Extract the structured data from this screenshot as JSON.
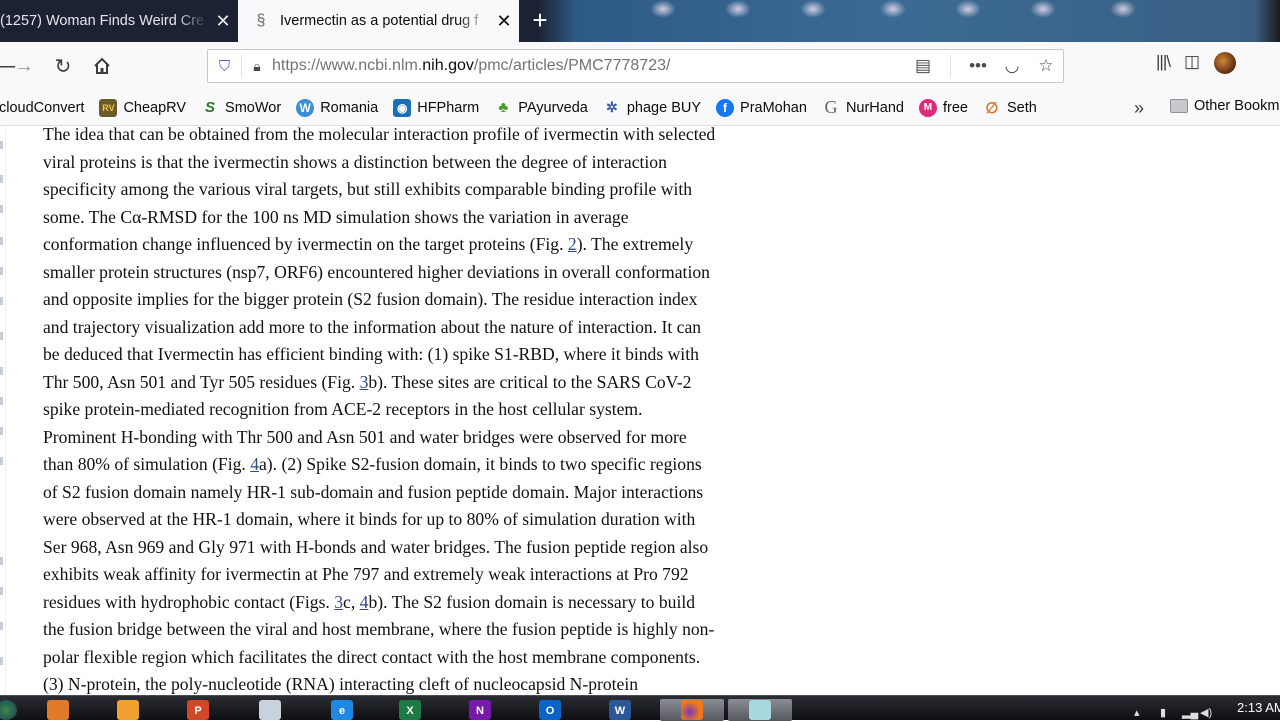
{
  "browser": {
    "tabs": [
      {
        "title": "(1257) Woman Finds Weird Cre",
        "active": false,
        "favicon": "youtube-icon"
      },
      {
        "title": "Ivermectin as a potential drug f",
        "active": true,
        "favicon": "ncbi-helix-icon"
      }
    ],
    "new_tab_label": "+",
    "url_prefix": "https://www.ncbi.nlm.",
    "url_domain": "nih.gov",
    "url_suffix": "/pmc/articles/PMC7778723/",
    "bookmarks": [
      {
        "label": "cloudConvert",
        "icon": "cloudconvert-icon"
      },
      {
        "label": "CheapRV",
        "icon": "rv-icon"
      },
      {
        "label": "SmoWor",
        "icon": "smowor-icon"
      },
      {
        "label": "Romania",
        "icon": "wordpress-icon"
      },
      {
        "label": "HFPharm",
        "icon": "hfpharm-icon"
      },
      {
        "label": "PAyurveda",
        "icon": "palm-icon"
      },
      {
        "label": "phage BUY",
        "icon": "phage-icon"
      },
      {
        "label": "PraMohan",
        "icon": "facebook-icon"
      },
      {
        "label": "NurHand",
        "icon": "google-icon"
      },
      {
        "label": "free",
        "icon": "m-icon"
      },
      {
        "label": "Seth",
        "icon": "seth-icon"
      }
    ],
    "other_bookmarks_label": "Other Bookmarks"
  },
  "article": {
    "lines": [
      [
        {
          "t": "The idea that can be obtained from the molecular interaction profile of ivermectin with selected"
        }
      ],
      [
        {
          "t": "viral proteins is that the ivermectin shows a distinction between the degree of interaction"
        }
      ],
      [
        {
          "t": "specificity among the various viral targets, but still exhibits comparable binding profile with"
        }
      ],
      [
        {
          "t": "some. The Cα-RMSD for the 100 ns MD simulation shows the variation in average"
        }
      ],
      [
        {
          "t": "conformation change influenced by ivermectin on the target proteins (Fig. "
        },
        {
          "t": "2",
          "link": true
        },
        {
          "t": "). The extremely"
        }
      ],
      [
        {
          "t": "smaller protein structures (nsp7, ORF6) encountered higher deviations in overall conformation"
        }
      ],
      [
        {
          "t": "and opposite implies for the bigger protein (S2 fusion domain). The residue interaction index"
        }
      ],
      [
        {
          "t": "and trajectory visualization add more to the information about the nature of interaction. It can"
        }
      ],
      [
        {
          "t": "be deduced that Ivermectin has efficient binding with: (1) spike S1-RBD, where it binds with"
        }
      ],
      [
        {
          "t": "Thr 500, Asn 501 and Tyr 505 residues (Fig. "
        },
        {
          "t": "3",
          "link": true
        },
        {
          "t": "b). These sites are critical to the SARS CoV-2"
        }
      ],
      [
        {
          "t": "spike protein-mediated recognition from ACE-2 receptors in the host cellular system."
        }
      ],
      [
        {
          "t": "Prominent H-bonding with Thr 500 and Asn 501 and water bridges were observed for more"
        }
      ],
      [
        {
          "t": "than 80% of simulation (Fig. "
        },
        {
          "t": "4",
          "link": true
        },
        {
          "t": "a). (2) Spike S2-fusion domain, it binds to two specific regions"
        }
      ],
      [
        {
          "t": "of S2 fusion domain namely HR-1 sub-domain and fusion peptide domain. Major interactions"
        }
      ],
      [
        {
          "t": "were observed at the HR-1 domain, where it binds for up to 80% of simulation duration with"
        }
      ],
      [
        {
          "t": "Ser 968, Asn 969 and Gly 971 with H-bonds and water bridges. The fusion peptide region also"
        }
      ],
      [
        {
          "t": "exhibits weak affinity for ivermectin at Phe 797 and extremely weak interactions at Pro 792"
        }
      ],
      [
        {
          "t": "residues with hydrophobic contact (Figs. "
        },
        {
          "t": "3",
          "link": true
        },
        {
          "t": "c, "
        },
        {
          "t": "4",
          "link": true
        },
        {
          "t": "b). The S2 fusion domain is necessary to build"
        }
      ],
      [
        {
          "t": "the fusion bridge between the viral and host membrane, where the fusion peptide is highly non-"
        }
      ],
      [
        {
          "t": "polar flexible region which facilitates the direct contact with the host membrane components."
        }
      ],
      [
        {
          "t": "(3) N-protein, the poly-nucleotide (RNA) interacting cleft of nucleocapsid N-protein"
        }
      ]
    ]
  },
  "taskbar": {
    "apps": [
      {
        "name": "media-player",
        "letter": "",
        "color": "#e07a2a"
      },
      {
        "name": "photos",
        "letter": "",
        "color": "#f0a030"
      },
      {
        "name": "powerpoint",
        "letter": "P",
        "color": "#d24726"
      },
      {
        "name": "window",
        "letter": "",
        "color": "#c8d2dc"
      },
      {
        "name": "internet-explorer",
        "letter": "e",
        "color": "#1e88e5"
      },
      {
        "name": "excel",
        "letter": "X",
        "color": "#1d7a45"
      },
      {
        "name": "onenote",
        "letter": "N",
        "color": "#7719aa"
      },
      {
        "name": "outlook",
        "letter": "O",
        "color": "#0a64c8"
      },
      {
        "name": "word",
        "letter": "W",
        "color": "#2b5797"
      }
    ],
    "clock": "2:13 AM"
  }
}
